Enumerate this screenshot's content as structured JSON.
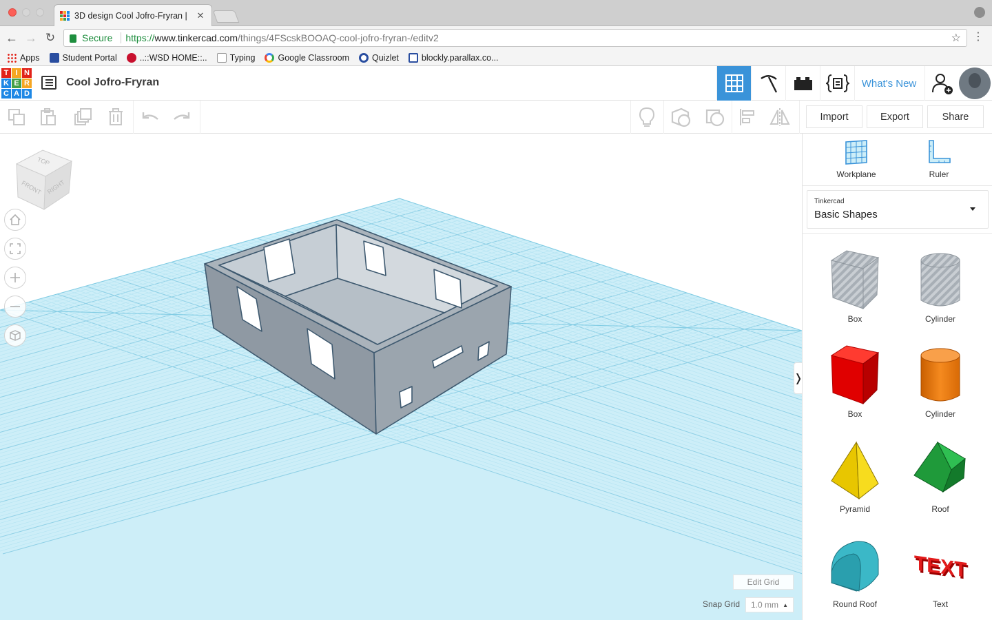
{
  "browser": {
    "tab_title": "3D design Cool Jofro-Fryran |",
    "secure_label": "Secure",
    "url_scheme": "https://",
    "url_host": "www.tinkercad.com",
    "url_path": "/things/4FScskBOOAQ-cool-jofro-fryran-/editv2",
    "bookmarks": [
      "Apps",
      "Student Portal",
      "..::WSD HOME::..",
      "Typing",
      "Google Classroom",
      "Quizlet",
      "blockly.parallax.co..."
    ]
  },
  "app": {
    "logo_letters": [
      "T",
      "I",
      "N",
      "K",
      "E",
      "R",
      "C",
      "A",
      "D"
    ],
    "design_title": "Cool Jofro-Fryran",
    "whats_new": "What's New"
  },
  "toolbar": {
    "import_label": "Import",
    "export_label": "Export",
    "share_label": "Share"
  },
  "viewport": {
    "view_cube": {
      "top": "TOP",
      "front": "FRONT",
      "right": "RIGHT"
    },
    "edit_grid": "Edit Grid",
    "snap_grid_label": "Snap Grid",
    "snap_grid_value": "1.0 mm"
  },
  "panel": {
    "workplane": "Workplane",
    "ruler": "Ruler",
    "library_small": "Tinkercad",
    "library_name": "Basic Shapes",
    "shapes": [
      {
        "label": "Box"
      },
      {
        "label": "Cylinder"
      },
      {
        "label": "Box"
      },
      {
        "label": "Cylinder"
      },
      {
        "label": "Pyramid"
      },
      {
        "label": "Roof"
      },
      {
        "label": "Round Roof"
      },
      {
        "label": "Text"
      }
    ]
  },
  "colors": {
    "accent": "#3a93d9",
    "grid": "#a9dff0",
    "model": "#9aa4ad",
    "box_red": "#e00000",
    "cylinder_orange": "#ee7b0e",
    "pyramid_yellow": "#e8c600",
    "roof_green": "#1f9a3a",
    "round_roof_teal": "#3bb8c7"
  }
}
